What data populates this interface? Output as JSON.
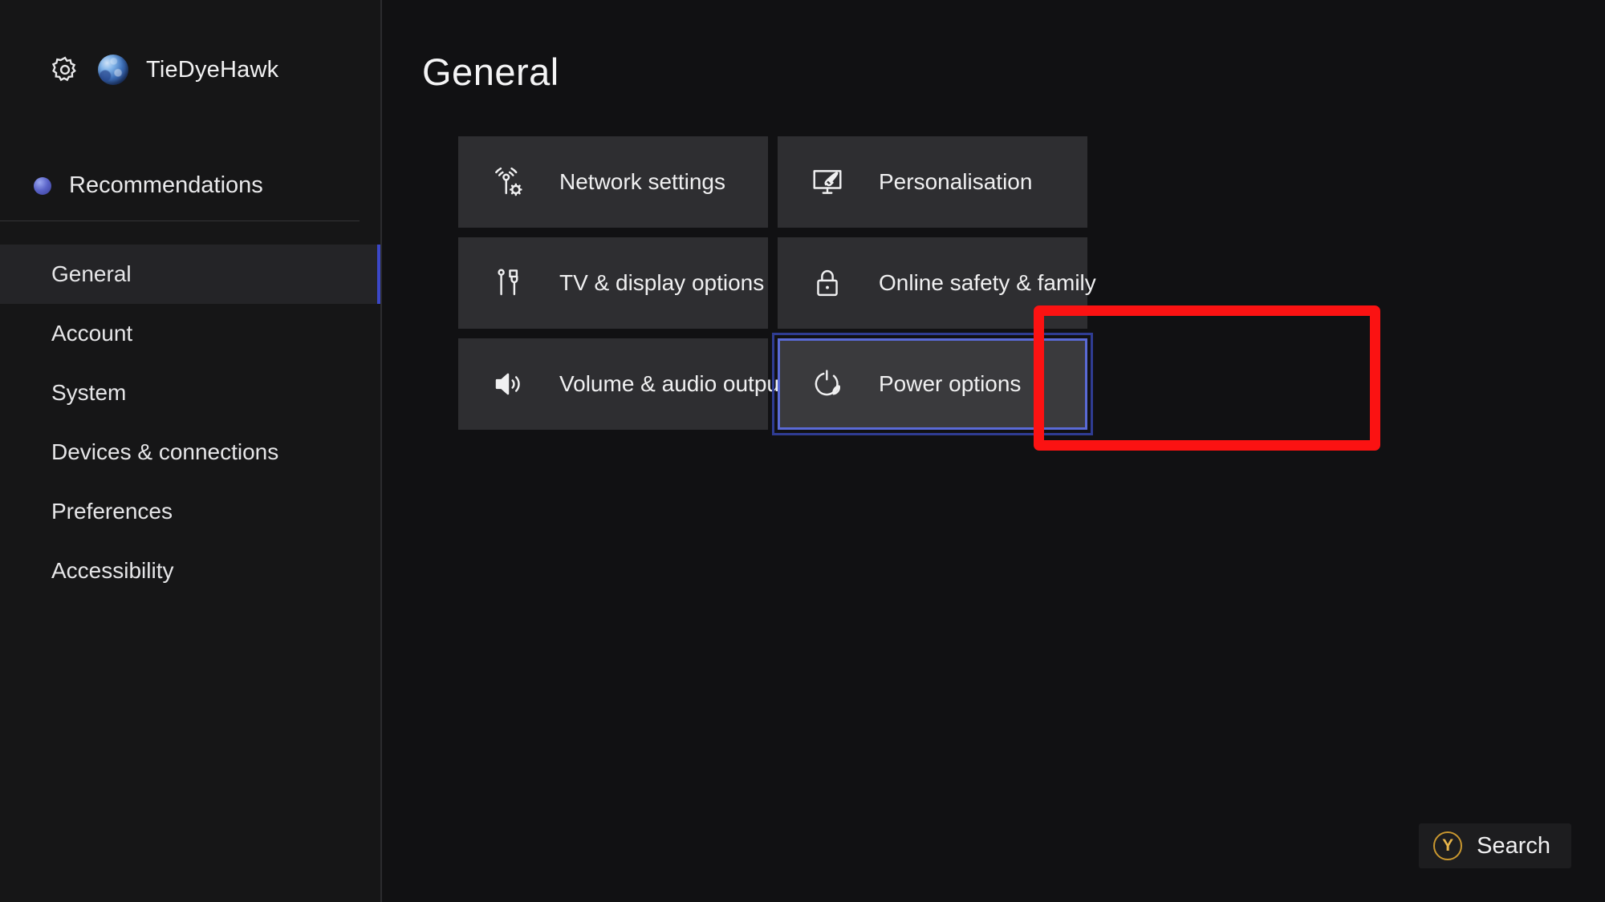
{
  "sidebar": {
    "profile": {
      "gear_icon": "gear-icon",
      "avatar_icon": "avatar",
      "username": "TieDyeHawk"
    },
    "recommendations": {
      "icon": "recommendations-dot-icon",
      "label": "Recommendations"
    },
    "nav_items": [
      {
        "label": "General",
        "selected": true
      },
      {
        "label": "Account",
        "selected": false
      },
      {
        "label": "System",
        "selected": false
      },
      {
        "label": "Devices & connections",
        "selected": false
      },
      {
        "label": "Preferences",
        "selected": false
      },
      {
        "label": "Accessibility",
        "selected": false
      }
    ]
  },
  "main": {
    "title": "General",
    "tiles": [
      {
        "label": "Network settings",
        "icon": "network-wireless-gear-icon",
        "focused": false
      },
      {
        "label": "Personalisation",
        "icon": "monitor-paintbrush-icon",
        "focused": false
      },
      {
        "label": "TV & display options",
        "icon": "cable-plug-icon",
        "focused": false
      },
      {
        "label": "Online safety & family",
        "icon": "lock-icon",
        "focused": false
      },
      {
        "label": "Volume & audio output",
        "icon": "speaker-volume-icon",
        "focused": false
      },
      {
        "label": "Power options",
        "icon": "power-leaf-icon",
        "focused": true
      }
    ]
  },
  "search": {
    "button_glyph": "Y",
    "label": "Search"
  },
  "colors": {
    "accent_blue": "#3b47c8",
    "focus_border": "#5a6ad6",
    "annotation_red": "#fb1212",
    "badge_gold": "#e8b54a",
    "tile_bg": "#2e2e31",
    "sidebar_bg": "#161617",
    "page_bg": "#111113"
  }
}
